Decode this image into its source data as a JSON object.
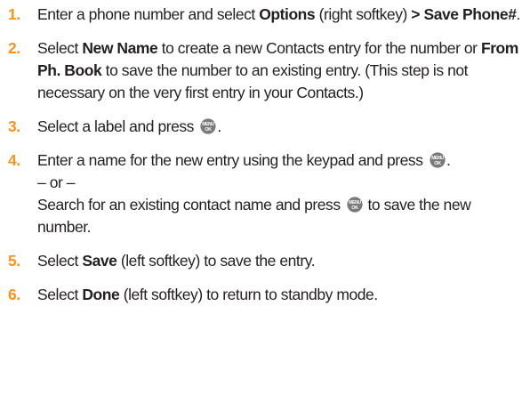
{
  "steps": [
    {
      "number": "1.",
      "parts": {
        "t1": "Enter a phone number and select ",
        "b1": "Options",
        "t2": " (right softkey) ",
        "b2": ">",
        "t3": " ",
        "b3": "Save Phone#",
        "t4": "."
      }
    },
    {
      "number": "2.",
      "parts": {
        "t1": "Select ",
        "b1": "New Name",
        "t2": " to create a new Contacts entry for the number or ",
        "b2": "From Ph. Book",
        "t3": " to save the number to an existing entry. (This step is not necessary on the very first entry in your Contacts.)"
      }
    },
    {
      "number": "3.",
      "parts": {
        "t1": "Select a label and press ",
        "t2": "."
      }
    },
    {
      "number": "4.",
      "parts": {
        "t1": "Enter a name for the new entry using the keypad and press ",
        "t2": ".",
        "or": "– or –",
        "t3": "Search for an existing contact name and press ",
        "t4": " to save the new number."
      }
    },
    {
      "number": "5.",
      "parts": {
        "t1": "Select ",
        "b1": "Save",
        "t2": " (left softkey) to save the entry."
      }
    },
    {
      "number": "6.",
      "parts": {
        "t1": "Select ",
        "b1": "Done",
        "t2": " (left softkey) to return to standby mode."
      }
    }
  ],
  "key_icon": {
    "name": "menu-ok-key-icon",
    "top_label": "MENU",
    "bottom_label": "OK",
    "color": "#7a7a7a"
  },
  "colors": {
    "number": "#f7941d",
    "text": "#231f20"
  }
}
